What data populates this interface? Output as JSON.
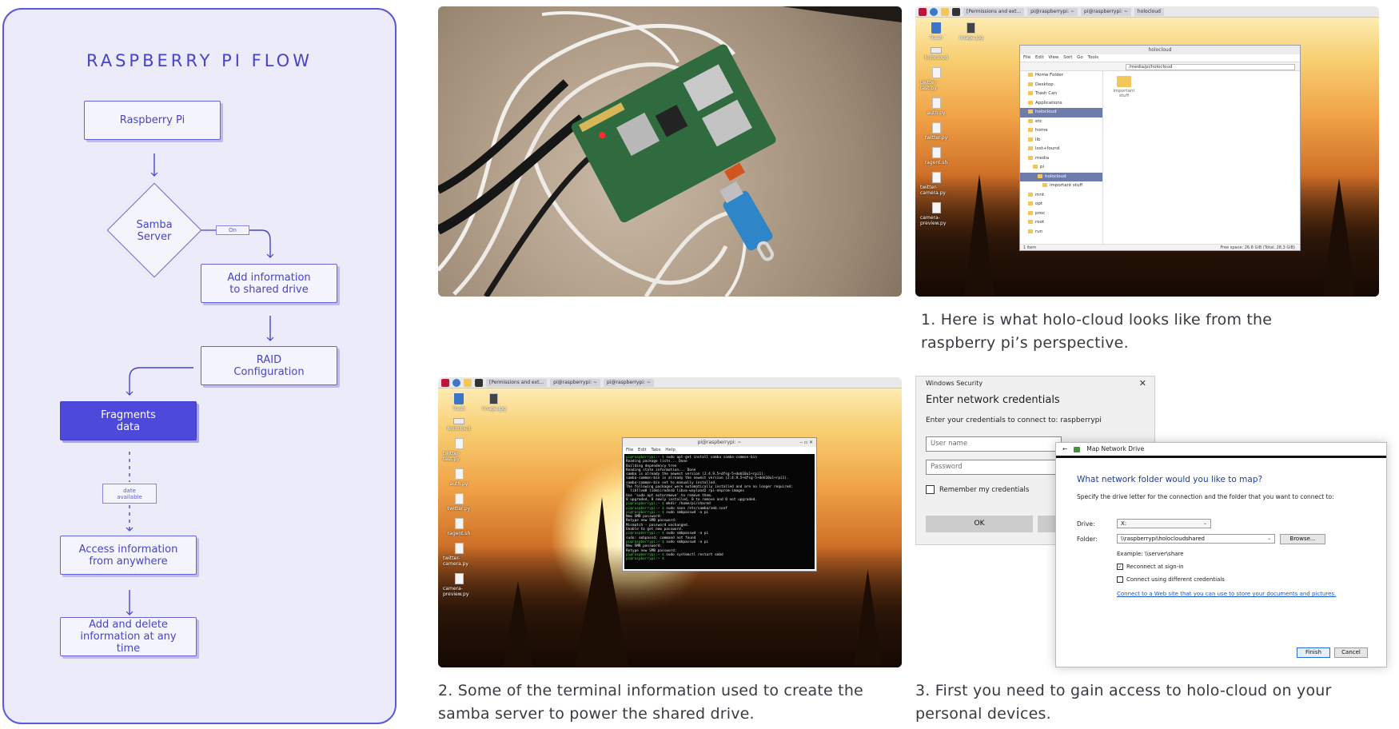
{
  "flowchart": {
    "title": "RASPBERRY PI FLOW",
    "nodes": {
      "raspberry_pi": "Raspberry Pi",
      "samba_server": "Samba\nServer",
      "on_tag": "On",
      "add_information": "Add information\nto shared drive",
      "raid": "RAID\nConfiguration",
      "fragments": "Fragments\ndata",
      "date_available": "date\navailable",
      "access": "Access information\nfrom anywhere",
      "add_delete": "Add and delete\ninformation at any\ntime"
    },
    "colors": {
      "accent": "#4c49db",
      "panel_bg": "#ebebfa",
      "border": "#5b59d9"
    }
  },
  "desktop1": {
    "taskbar": [
      "[Permissions and ext...",
      "pi@raspberrypi: ~",
      "pi@raspberrypi: ~",
      "holocloud"
    ],
    "icons": [
      "Trash",
      "image.jpg",
      "holocloud",
      "twitter-test.py",
      "auth.py",
      "twitter.py",
      "ragent.sh",
      "twitter-camera.py",
      "camera-preview.py"
    ],
    "file_manager": {
      "title": "holocloud",
      "menu": "File Edit View Sort Go Tools",
      "path": "/media/pi/holocloud",
      "tree": [
        "Home Folder",
        "Desktop",
        "Trash Can",
        "Applications",
        "holocloud",
        "etc",
        "home",
        "lib",
        "lost+found",
        "media",
        "pi",
        "holocloud",
        "important stuff",
        "mnt",
        "opt",
        "proc",
        "root",
        "run"
      ],
      "selected_index": 4,
      "folder_item": "important stuff",
      "status_left": "1 item",
      "status_right": "Free space: 26.8 GiB (Total: 28.3 GiB)"
    }
  },
  "desktop2": {
    "taskbar": [
      "[Permissions and ext...",
      "pi@raspberrypi: ~",
      "pi@raspberrypi: ~"
    ],
    "icons": [
      "Trash",
      "image.jpg",
      "holocloud",
      "twitter-test.py",
      "auth.py",
      "twitter.py",
      "ragent.sh",
      "twitter-camera.py",
      "camera-preview.py"
    ],
    "terminal": {
      "title": "pi@raspberrypi: ~",
      "menu": "File Edit Tabs Help",
      "lines": [
        "pi@raspberrypi:~ $ sudo apt-get install samba samba-common-bin",
        "Reading package lists... Done",
        "Building dependency tree",
        "Reading state information... Done",
        "samba is already the newest version (2:4.9.5+dfsg-5+deb10u1+rpi1).",
        "samba-common-bin is already the newest version (2:4.9.5+dfsg-5+deb10u1+rpi1).",
        "samba-common-bin set to manually installed.",
        "The following packages were automatically installed and are no longer required:",
        "  libllvm8 libmicrodns0 libva-wayland2 rpi-eeprom-images",
        "Use 'sudo apt autoremove' to remove them.",
        "0 upgraded, 0 newly installed, 0 to remove and 0 not upgraded.",
        "pi@raspberrypi:~ $ mkdir /home/pi/shared",
        "pi@raspberrypi:~ $ sudo nano /etc/samba/smb.conf",
        "pi@raspberrypi:~ $ sudo smbpasswd -a pi",
        "New SMB password:",
        "Retype new SMB password:",
        "Mismatch - password unchanged.",
        "Unable to get new password.",
        "pi@raspberrypi:~ $ sudo smbpasswd -a pi",
        "sudo: smbpassd: command not found",
        "pi@raspberrypi:~ $ sudo smbpasswd -a pi",
        "New SMB password:",
        "Retype new SMB password:",
        "pi@raspberrypi:~ $ sudo systemctl restart smbd",
        "pi@raspberrypi:~ $"
      ]
    }
  },
  "credentials_dialog": {
    "header": "Windows Security",
    "title": "Enter network credentials",
    "subtitle": "Enter your credentials to connect to: raspberrypi",
    "username_placeholder": "User name",
    "password_placeholder": "Password",
    "remember": "Remember my credentials",
    "ok": "OK"
  },
  "map_drive_dialog": {
    "header": "Map Network Drive",
    "title": "What network folder would you like to map?",
    "subtitle": "Specify the drive letter for the connection and the folder that you want to connect to:",
    "drive_label": "Drive:",
    "drive_value": "X:",
    "folder_label": "Folder:",
    "folder_value": "\\\\raspberrypi\\holocloudshared",
    "browse": "Browse...",
    "example": "Example: \\\\server\\share",
    "reconnect": "Reconnect at sign-in",
    "reconnect_checked": true,
    "different_credentials": "Connect using different credentials",
    "different_credentials_checked": false,
    "link": "Connect to a Web site that you can use to store your documents and pictures.",
    "finish": "Finish",
    "cancel": "Cancel"
  },
  "captions": {
    "c1": "1. Here is what holo-cloud looks like from the raspberry pi’s perspective.",
    "c2": "2. Some of the terminal information used to create the samba server to power the shared drive.",
    "c3": "3. First you need to gain access to holo-cloud on your personal devices."
  }
}
